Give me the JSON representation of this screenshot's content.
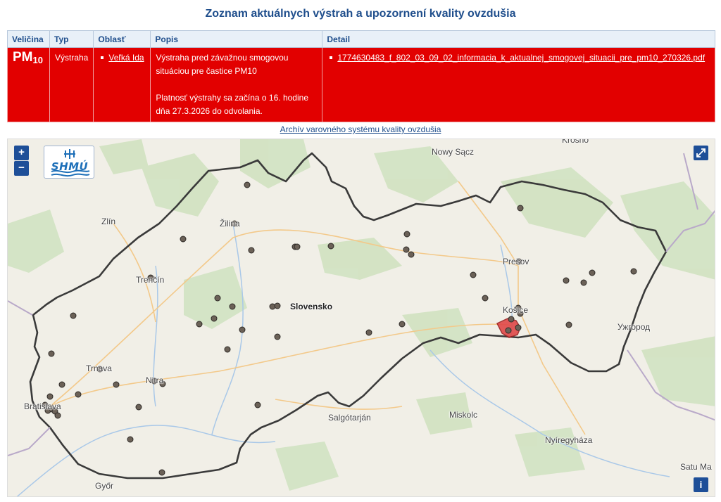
{
  "page_title": "Zoznam aktuálnych výstrah a upozornení kvality ovzdušia",
  "table": {
    "headers": [
      "Veličina",
      "Typ",
      "Oblasť",
      "Popis",
      "Detail"
    ],
    "row": {
      "quantity_main": "PM",
      "quantity_sub": "10",
      "type": "Výstraha",
      "area": "Veľká Ida",
      "description_1": "Výstraha pred závažnou smogovou situáciou pre častice PM10",
      "description_2": "Platnosť výstrahy sa začína o 16. hodine dňa 27.3.2026 do odvolania.",
      "detail_link": "1774630483_f_802_03_09_02_informacia_k_aktualnej_smogovej_situacii_pre_pm10_270326.pdf"
    }
  },
  "archive_link": "Archív varovného systému kvality ovzdušia",
  "map": {
    "zoom_in": "+",
    "zoom_out": "−",
    "logo": "SHMÚ",
    "fullscreen_icon": "expand-icon",
    "info_button": "i",
    "labels": {
      "krosno": "Krosno",
      "nowy_sacz": "Nowy Sącz",
      "zlin": "Zlín",
      "zilina": "Žilina",
      "presov": "Prešov",
      "trencin": "Trenčín",
      "slovensko": "Slovensko",
      "kosice": "Košice",
      "uzhorod": "Ужгород",
      "trnava": "Trnava",
      "nitra": "Nitra",
      "bratislava": "Bratislava",
      "salgotarjan": "Salgótarján",
      "miskolc": "Miskolc",
      "nyiregyhaza": "Nyíregyháza",
      "gyor": "Győr",
      "satu_mare": "Satu Ma"
    },
    "colors": {
      "alert_red": "#e20000",
      "border": "#3a3a3a",
      "station": "#6b6157",
      "button": "#1e4f98"
    }
  }
}
